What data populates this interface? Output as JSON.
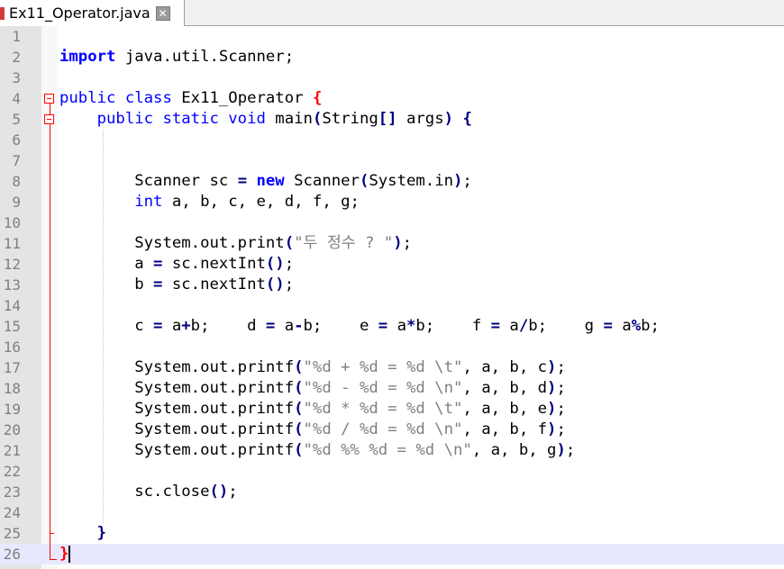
{
  "tab": {
    "title": "Ex11_Operator.java",
    "close_icon": "close-icon"
  },
  "editor": {
    "current_line": 26,
    "lines": [
      {
        "n": "1",
        "tokens": []
      },
      {
        "n": "2",
        "tokens": [
          {
            "t": "import",
            "c": "kwb"
          },
          {
            "t": " java.util.Scanner;",
            "c": ""
          }
        ]
      },
      {
        "n": "3",
        "tokens": []
      },
      {
        "n": "4",
        "tokens": [
          {
            "t": "public class",
            "c": "kw"
          },
          {
            "t": " Ex11_Operator ",
            "c": ""
          },
          {
            "t": "{",
            "c": "red"
          }
        ]
      },
      {
        "n": "5",
        "tokens": [
          {
            "t": "    public static void",
            "c": "kw"
          },
          {
            "t": " main",
            "c": ""
          },
          {
            "t": "(",
            "c": "op"
          },
          {
            "t": "String",
            "c": ""
          },
          {
            "t": "[]",
            "c": "op"
          },
          {
            "t": " args",
            "c": ""
          },
          {
            "t": ")",
            "c": "op"
          },
          {
            "t": " ",
            "c": ""
          },
          {
            "t": "{",
            "c": "op"
          }
        ]
      },
      {
        "n": "6",
        "tokens": []
      },
      {
        "n": "7",
        "tokens": []
      },
      {
        "n": "8",
        "tokens": [
          {
            "t": "        Scanner sc ",
            "c": ""
          },
          {
            "t": "=",
            "c": "op"
          },
          {
            "t": " ",
            "c": ""
          },
          {
            "t": "new",
            "c": "kwb"
          },
          {
            "t": " Scanner",
            "c": ""
          },
          {
            "t": "(",
            "c": "op"
          },
          {
            "t": "System.in",
            "c": ""
          },
          {
            "t": ")",
            "c": "op"
          },
          {
            "t": ";",
            "c": ""
          }
        ]
      },
      {
        "n": "9",
        "tokens": [
          {
            "t": "        ",
            "c": ""
          },
          {
            "t": "int",
            "c": "kw"
          },
          {
            "t": " a, b, c, e, d, f, g;",
            "c": ""
          }
        ]
      },
      {
        "n": "10",
        "tokens": []
      },
      {
        "n": "11",
        "tokens": [
          {
            "t": "        System.out.print",
            "c": ""
          },
          {
            "t": "(",
            "c": "op"
          },
          {
            "t": "\"두 정수 ? \"",
            "c": "str"
          },
          {
            "t": ")",
            "c": "op"
          },
          {
            "t": ";",
            "c": ""
          }
        ]
      },
      {
        "n": "12",
        "tokens": [
          {
            "t": "        a ",
            "c": ""
          },
          {
            "t": "=",
            "c": "op"
          },
          {
            "t": " sc.nextInt",
            "c": ""
          },
          {
            "t": "()",
            "c": "op"
          },
          {
            "t": ";",
            "c": ""
          }
        ]
      },
      {
        "n": "13",
        "tokens": [
          {
            "t": "        b ",
            "c": ""
          },
          {
            "t": "=",
            "c": "op"
          },
          {
            "t": " sc.nextInt",
            "c": ""
          },
          {
            "t": "()",
            "c": "op"
          },
          {
            "t": ";",
            "c": ""
          }
        ]
      },
      {
        "n": "14",
        "tokens": []
      },
      {
        "n": "15",
        "tokens": [
          {
            "t": "        c ",
            "c": ""
          },
          {
            "t": "=",
            "c": "op"
          },
          {
            "t": " a",
            "c": ""
          },
          {
            "t": "+",
            "c": "op"
          },
          {
            "t": "b;    d ",
            "c": ""
          },
          {
            "t": "=",
            "c": "op"
          },
          {
            "t": " a",
            "c": ""
          },
          {
            "t": "-",
            "c": "op"
          },
          {
            "t": "b;    e ",
            "c": ""
          },
          {
            "t": "=",
            "c": "op"
          },
          {
            "t": " a",
            "c": ""
          },
          {
            "t": "*",
            "c": "op"
          },
          {
            "t": "b;    f ",
            "c": ""
          },
          {
            "t": "=",
            "c": "op"
          },
          {
            "t": " a",
            "c": ""
          },
          {
            "t": "/",
            "c": "op"
          },
          {
            "t": "b;    g ",
            "c": ""
          },
          {
            "t": "=",
            "c": "op"
          },
          {
            "t": " a",
            "c": ""
          },
          {
            "t": "%",
            "c": "op"
          },
          {
            "t": "b;",
            "c": ""
          }
        ]
      },
      {
        "n": "16",
        "tokens": []
      },
      {
        "n": "17",
        "tokens": [
          {
            "t": "        System.out.printf",
            "c": ""
          },
          {
            "t": "(",
            "c": "op"
          },
          {
            "t": "\"%d + %d = %d \\t\"",
            "c": "str"
          },
          {
            "t": ", a, b, c",
            "c": ""
          },
          {
            "t": ")",
            "c": "op"
          },
          {
            "t": ";",
            "c": ""
          }
        ]
      },
      {
        "n": "18",
        "tokens": [
          {
            "t": "        System.out.printf",
            "c": ""
          },
          {
            "t": "(",
            "c": "op"
          },
          {
            "t": "\"%d - %d = %d \\n\"",
            "c": "str"
          },
          {
            "t": ", a, b, d",
            "c": ""
          },
          {
            "t": ")",
            "c": "op"
          },
          {
            "t": ";",
            "c": ""
          }
        ]
      },
      {
        "n": "19",
        "tokens": [
          {
            "t": "        System.out.printf",
            "c": ""
          },
          {
            "t": "(",
            "c": "op"
          },
          {
            "t": "\"%d * %d = %d \\t\"",
            "c": "str"
          },
          {
            "t": ", a, b, e",
            "c": ""
          },
          {
            "t": ")",
            "c": "op"
          },
          {
            "t": ";",
            "c": ""
          }
        ]
      },
      {
        "n": "20",
        "tokens": [
          {
            "t": "        System.out.printf",
            "c": ""
          },
          {
            "t": "(",
            "c": "op"
          },
          {
            "t": "\"%d / %d = %d \\n\"",
            "c": "str"
          },
          {
            "t": ", a, b, f",
            "c": ""
          },
          {
            "t": ")",
            "c": "op"
          },
          {
            "t": ";",
            "c": ""
          }
        ]
      },
      {
        "n": "21",
        "tokens": [
          {
            "t": "        System.out.printf",
            "c": ""
          },
          {
            "t": "(",
            "c": "op"
          },
          {
            "t": "\"%d %% %d = %d \\n\"",
            "c": "str"
          },
          {
            "t": ", a, b, g",
            "c": ""
          },
          {
            "t": ")",
            "c": "op"
          },
          {
            "t": ";",
            "c": ""
          }
        ]
      },
      {
        "n": "22",
        "tokens": []
      },
      {
        "n": "23",
        "tokens": [
          {
            "t": "        sc.close",
            "c": ""
          },
          {
            "t": "()",
            "c": "op"
          },
          {
            "t": ";",
            "c": ""
          }
        ]
      },
      {
        "n": "24",
        "tokens": []
      },
      {
        "n": "25",
        "tokens": [
          {
            "t": "    ",
            "c": ""
          },
          {
            "t": "}",
            "c": "op"
          }
        ]
      },
      {
        "n": "26",
        "tokens": [
          {
            "t": "}",
            "c": "red"
          }
        ]
      }
    ]
  }
}
